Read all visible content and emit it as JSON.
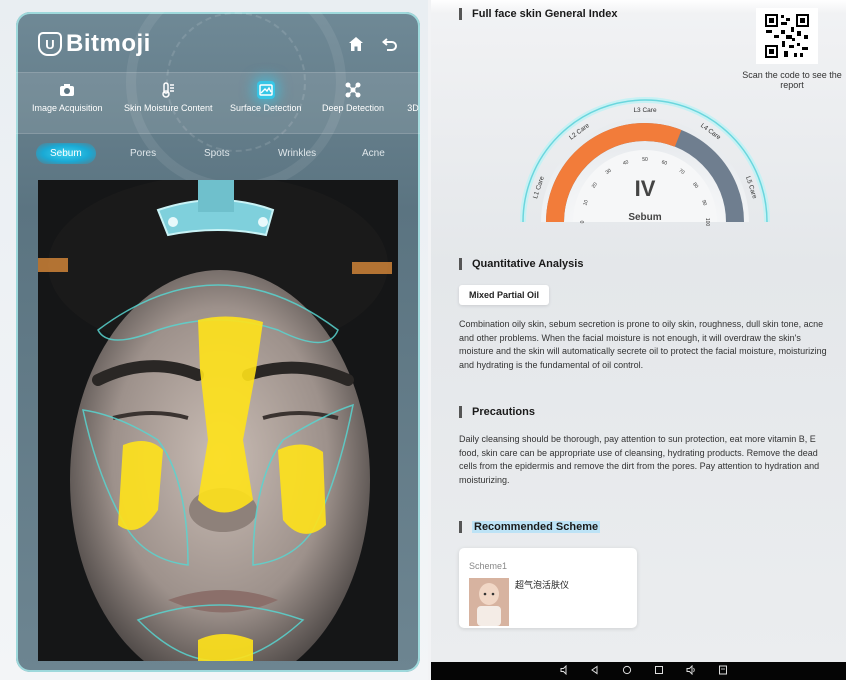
{
  "app": {
    "brand": "Bitmoji",
    "logo_letter": "U"
  },
  "modes": [
    {
      "label": "Image Acquisition",
      "icon": "camera-icon"
    },
    {
      "label": "Skin Moisture Content",
      "icon": "thermometer-icon"
    },
    {
      "label": "Surface Detection",
      "icon": "image-icon",
      "active": true
    },
    {
      "label": "Deep Detection",
      "icon": "network-icon"
    },
    {
      "label": "3D",
      "icon": "cube-icon"
    }
  ],
  "subtabs": [
    {
      "label": "Sebum",
      "active": true
    },
    {
      "label": "Pores"
    },
    {
      "label": "Spots"
    },
    {
      "label": "Wrinkles"
    },
    {
      "label": "Acne"
    }
  ],
  "report": {
    "general_title": "Full face skin General Index",
    "qr_caption": "Scan the code to see the report",
    "gauge": {
      "grade": "IV",
      "metric": "Sebum",
      "levels": [
        "L1 Care",
        "L2 Care",
        "L3 Care",
        "L4 Care",
        "L5 Care"
      ],
      "ticks": [
        "0",
        "10",
        "20",
        "30",
        "40",
        "50",
        "60",
        "70",
        "80",
        "90",
        "100"
      ],
      "fill_fraction": 0.62
    },
    "quant_title": "Quantitative Analysis",
    "skin_type": "Mixed Partial Oil",
    "quant_text": "Combination oily skin, sebum secretion is prone to oily skin, roughness, dull skin tone, acne and other problems. When the facial moisture is not enough, it will overdraw the skin's moisture and the skin will automatically secrete oil to protect the facial moisture, moisturizing and hydrating is the fundamental of oil control.",
    "precautions_title": "Precautions",
    "precautions_text": "Daily cleansing should be thorough, pay attention to sun protection, eat more vitamin B, E food, skin care can be appropriate use of cleansing, hydrating products. Remove the dead cells from the epidermis and remove the dirt from the pores. Pay attention to hydration and moisturizing.",
    "scheme_title": "Recommended Scheme",
    "scheme": {
      "name": "Scheme1",
      "product": "超气泡活肤仪"
    }
  },
  "colors": {
    "accent": "#37c6e6",
    "gauge_orange": "#f27c3a",
    "gauge_grey": "#6f7e8f",
    "sebum_yellow": "#ffe21a"
  },
  "system_nav": [
    "volume-down-icon",
    "back-icon",
    "home-icon",
    "recents-icon",
    "volume-up-icon",
    "screenshot-icon"
  ]
}
